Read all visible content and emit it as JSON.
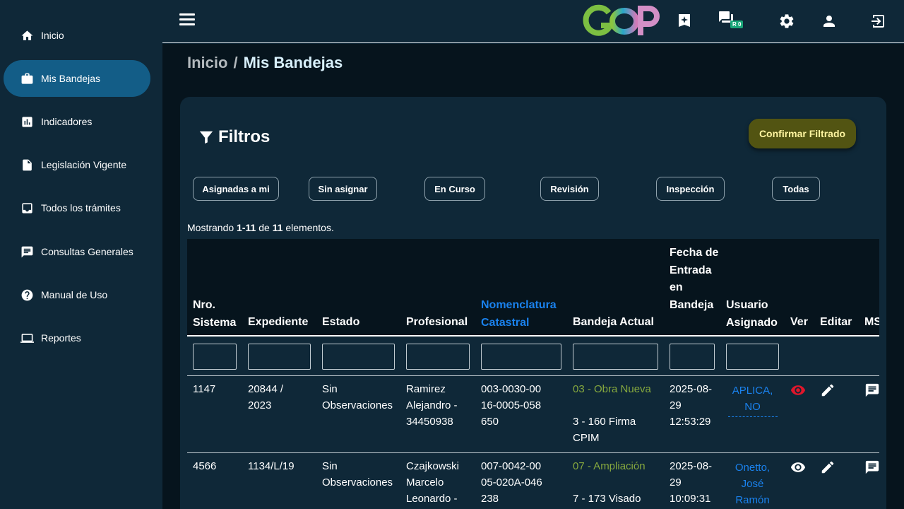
{
  "sidebar": {
    "items": [
      {
        "label": "Inicio",
        "icon": "home-icon"
      },
      {
        "label": "Mis Bandejas",
        "icon": "briefcase-icon",
        "active": true
      },
      {
        "label": "Indicadores",
        "icon": "bar-chart-icon"
      },
      {
        "label": "Legislación Vigente",
        "icon": "document-icon"
      },
      {
        "label": "Todos los trámites",
        "icon": "inbox-icon"
      },
      {
        "label": "Consultas Generales",
        "icon": "chat-icon"
      },
      {
        "label": "Manual de Uso",
        "icon": "help-icon"
      },
      {
        "label": "Reportes",
        "icon": "laptop-icon"
      }
    ]
  },
  "topbar": {
    "logo_text": "GOP",
    "chat_badge": "R 0",
    "icons": [
      "menu-icon",
      "sparkle-icon",
      "chat-icon",
      "settings-icon",
      "user-icon",
      "logout-icon"
    ]
  },
  "breadcrumb": {
    "home": "Inicio",
    "separator": "/",
    "current": "Mis Bandejas"
  },
  "filters": {
    "title": "Filtros",
    "confirm_label": "Confirmar Filtrado",
    "chips": [
      "Asignadas a mi",
      "Sin asignar",
      "En Curso",
      "Revisión",
      "Inspección",
      "Todas"
    ]
  },
  "summary": {
    "prefix": "Mostrando",
    "range": "1-11",
    "mid": "de",
    "total": "11",
    "suffix": "elementos."
  },
  "table": {
    "headers": {
      "nro": "Nro. Sistema",
      "expediente": "Expediente",
      "estado": "Estado",
      "profesional": "Profesional",
      "nomenclatura": "Nomenclatura Catastral",
      "bandeja": "Bandeja Actual",
      "fecha": "Fecha de Entrada en Bandeja",
      "usuario": "Usuario Asignado",
      "ver": "Ver",
      "editar": "Editar",
      "msg": "MS"
    },
    "rows": [
      {
        "nro": "1147",
        "expediente": "20844 / 2023",
        "estado": "Sin Observaciones",
        "profesional": "Ramirez Alejandro - 34450938",
        "nomenclatura": "003-0030-0016-0005-058650",
        "bandeja_tipo": "03 - Obra Nueva",
        "bandeja_paso": "3 - 160 Firma CPIM",
        "fecha": "2025-08-29 12:53:29",
        "usuario": "APLICA, NO",
        "ver_state": "highlighted"
      },
      {
        "nro": "4566",
        "expediente": "1134/L/19",
        "estado": "Sin Observaciones",
        "profesional": "Czajkowski Marcelo Leonardo -",
        "nomenclatura": "007-0042-0005-020A-046238",
        "bandeja_tipo": "07 - Ampliación",
        "bandeja_paso": "7 - 173 Visado",
        "fecha": "2025-08-29 10:09:31",
        "usuario": "Onetto, José Ramón",
        "ver_state": "normal"
      }
    ]
  },
  "colors": {
    "sidebar_bg": "#0f2838",
    "active_item": "#135d87",
    "main_bg": "#06141d",
    "confirm_btn": "#525412",
    "link_blue": "#1a82ee",
    "green_text": "#86a83e",
    "eye_red": "#e0162b"
  }
}
